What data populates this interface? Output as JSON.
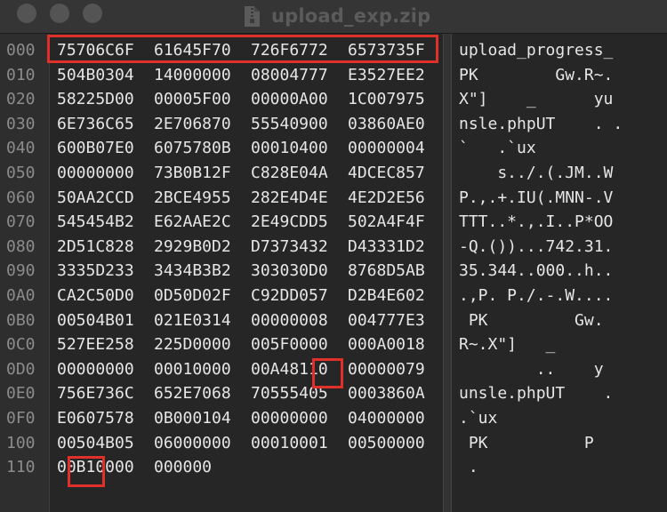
{
  "window": {
    "title": "upload_exp.zip",
    "file_icon": "zip-file-icon"
  },
  "colors": {
    "highlight": "#e0302a",
    "text": "#e6e6e6",
    "offset_text": "#8c8c8c"
  },
  "rows": [
    {
      "offset": "000",
      "hex": [
        "75706C6F",
        "61645F70",
        "726F6772",
        "6573735F"
      ],
      "ascii": "upload_progress_"
    },
    {
      "offset": "010",
      "hex": [
        "504B0304",
        "14000000",
        "08004777",
        "E3527EE2"
      ],
      "ascii": "PK        Gw.R~."
    },
    {
      "offset": "020",
      "hex": [
        "58225D00",
        "00005F00",
        "00000A00",
        "1C007975"
      ],
      "ascii": "X\"]    _      yu"
    },
    {
      "offset": "030",
      "hex": [
        "6E736C65",
        "2E706870",
        "55540900",
        "03860AE0"
      ],
      "ascii": "nsle.phpUT    . ."
    },
    {
      "offset": "040",
      "hex": [
        "600B07E0",
        "6075780B",
        "00010400",
        "00000004"
      ],
      "ascii": "`   .`ux"
    },
    {
      "offset": "050",
      "hex": [
        "00000000",
        "73B0B12F",
        "C828E04A",
        "4DCEC857"
      ],
      "ascii": "    s../.(.JM..W"
    },
    {
      "offset": "060",
      "hex": [
        "50AA2CCD",
        "2BCE4955",
        "282E4D4E",
        "4E2D2E56"
      ],
      "ascii": "P.,.+.IU(.MNN-.V"
    },
    {
      "offset": "070",
      "hex": [
        "545454B2",
        "E62AAE2C",
        "2E49CDD5",
        "502A4F4F"
      ],
      "ascii": "TTT..*.,.I..P*OO"
    },
    {
      "offset": "080",
      "hex": [
        "2D51C828",
        "2929B0D2",
        "D7373432",
        "D43331D2"
      ],
      "ascii": "-Q.())...742.31."
    },
    {
      "offset": "090",
      "hex": [
        "3335D233",
        "3434B3B2",
        "303030D0",
        "8768D5AB"
      ],
      "ascii": "35.344..000..h.."
    },
    {
      "offset": "0A0",
      "hex": [
        "CA2C50D0",
        "0D50D02F",
        "C92DD057",
        "D2B4E602"
      ],
      "ascii": ".,P. P./.-.W...."
    },
    {
      "offset": "0B0",
      "hex": [
        "00504B01",
        "021E0314",
        "00000008",
        "004777E3"
      ],
      "ascii": " PK         Gw."
    },
    {
      "offset": "0C0",
      "hex": [
        "527EE258",
        "225D0000",
        "005F0000",
        "000A0018"
      ],
      "ascii": "R~.X\"]   _"
    },
    {
      "offset": "0D0",
      "hex": [
        "00000000",
        "00010000",
        "00A48110",
        "00000079"
      ],
      "ascii": "        ..    y"
    },
    {
      "offset": "0E0",
      "hex": [
        "756E736C",
        "652E7068",
        "70555405",
        "0003860A"
      ],
      "ascii": "unsle.phpUT    ."
    },
    {
      "offset": "0F0",
      "hex": [
        "E0607578",
        "0B000104",
        "00000000",
        "04000000"
      ],
      "ascii": ".`ux"
    },
    {
      "offset": "100",
      "hex": [
        "00504B05",
        "06000000",
        "00010001",
        "00500000"
      ],
      "ascii": " PK          P"
    },
    {
      "offset": "110",
      "hex": [
        "00B10000",
        "000000",
        "",
        ""
      ],
      "ascii": " ."
    }
  ]
}
